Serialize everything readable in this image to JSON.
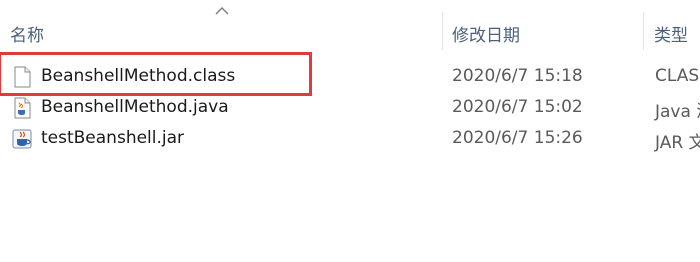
{
  "columns": {
    "name": "名称",
    "date_modified": "修改日期",
    "type": "类型"
  },
  "files": [
    {
      "icon": "blank-file-icon",
      "name": "BeanshellMethod.class",
      "date": "2020/6/7 15:18",
      "type": "CLAS"
    },
    {
      "icon": "java-file-icon",
      "name": "BeanshellMethod.java",
      "date": "2020/6/7 15:02",
      "type": "Java 源"
    },
    {
      "icon": "jar-file-icon",
      "name": "testBeanshell.jar",
      "date": "2020/6/7 15:26",
      "type": "JAR 文"
    }
  ],
  "colors": {
    "header_text": "#4c607a",
    "annotation_box": "#e0393e"
  }
}
